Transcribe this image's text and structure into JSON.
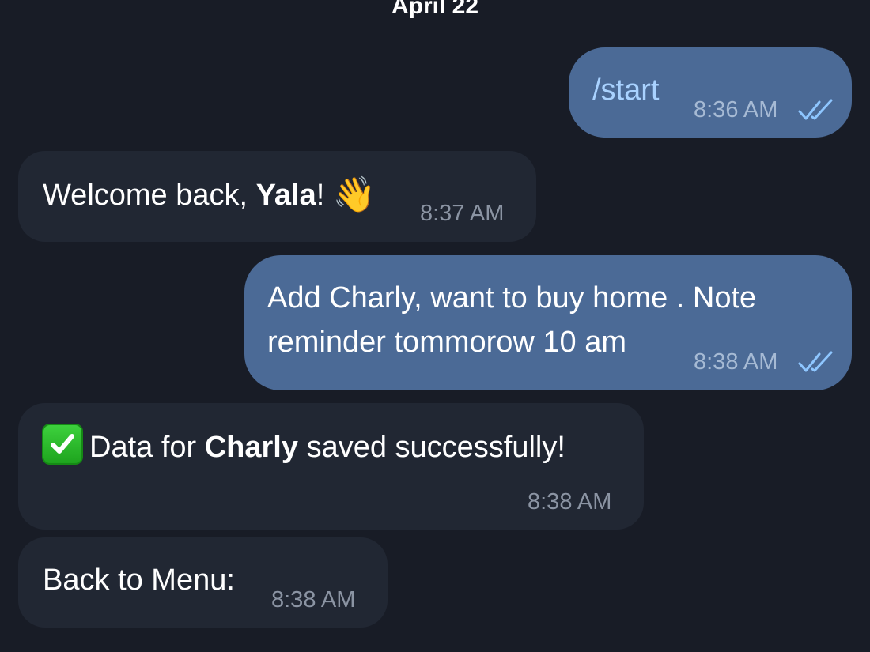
{
  "chat": {
    "date_separator": "April 22",
    "messages": [
      {
        "direction": "outgoing",
        "text": "/start",
        "time": "8:36 AM",
        "status": "read"
      },
      {
        "direction": "incoming",
        "text_prefix": "Welcome back, ",
        "text_bold": "Yala",
        "text_suffix": "!",
        "emoji": "👋",
        "time": "8:37 AM"
      },
      {
        "direction": "outgoing",
        "line1": "Add Charly, want to buy home . Note",
        "line2": "reminder tommorow 10 am",
        "time": "8:38 AM",
        "status": "read"
      },
      {
        "direction": "incoming",
        "icon": "check-mark-button-emoji",
        "text_prefix": "Data for ",
        "text_bold": "Charly",
        "text_suffix": " saved successfully!",
        "time": "8:38 AM"
      },
      {
        "direction": "incoming",
        "text": "Back to Menu:",
        "time": "8:38 AM"
      }
    ]
  },
  "colors": {
    "background": "#181c26",
    "incoming_bubble": "#212733",
    "outgoing_bubble": "#4b6a96",
    "command_link": "#a9d2ff",
    "read_ticks": "#8ec6ff"
  }
}
